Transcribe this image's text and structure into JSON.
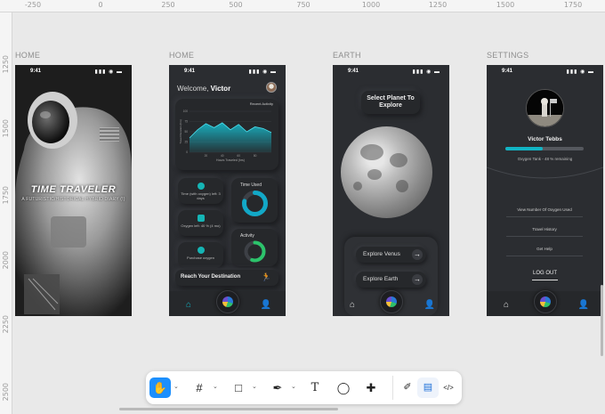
{
  "ruler": {
    "top": [
      "-250",
      "0",
      "250",
      "500",
      "750",
      "1000",
      "1250",
      "1500",
      "1750"
    ],
    "left": [
      "1250",
      "1500",
      "1750",
      "2000",
      "2250",
      "2500"
    ]
  },
  "frames": {
    "home_splash_label": "HOME",
    "home_dash_label": "HOME",
    "earth_label": "EARTH",
    "settings_label": "SETTINGS"
  },
  "status": {
    "time": "9:41",
    "icons": "▮▮▮ ◉ ▬"
  },
  "splash": {
    "title": "TIME TRAVELER",
    "subtitle": "A FUTURISTIC/HISTORICAL HYBRID DIARY (!)"
  },
  "dashboard": {
    "welcome_prefix": "Welcome,",
    "user_name": "Victor",
    "chart_title": "Recent Activity",
    "chart_xlabel": "Hours Traveled (hrs)",
    "chart_ylabel": "Travel Duration (hrs)",
    "tiles": [
      {
        "text": "Time (with oxygen) left: 3 days"
      },
      {
        "text": "Oxygen left: 40 % (4 mo)"
      },
      {
        "text": "Purchase oxygen"
      }
    ],
    "time_used_label": "Time Used",
    "activity_label": "Activity",
    "reach_label": "Reach Your Destination"
  },
  "chart_data": {
    "type": "area",
    "title": "Recent Activity",
    "xlabel": "Hours Traveled (hrs)",
    "ylabel": "Travel Duration (hrs)",
    "x": [
      0,
      10,
      20,
      30,
      40,
      50,
      60,
      70,
      80,
      90,
      100
    ],
    "xticks": [
      "20",
      "40",
      "60",
      "80"
    ],
    "yticks": [
      "0",
      "25",
      "50",
      "75",
      "100"
    ],
    "values": [
      35,
      55,
      70,
      60,
      72,
      55,
      68,
      50,
      62,
      58,
      48
    ],
    "ylim": [
      0,
      100
    ],
    "color": "#17b3c4"
  },
  "donut": {
    "fraction": 0.78,
    "color": "#12a8c7"
  },
  "activity_ring": {
    "fraction": 0.55,
    "color": "#2cc36b"
  },
  "earth": {
    "title": "Select Planet To Explore",
    "buttons": [
      "Explore Venus",
      "Explore Earth"
    ]
  },
  "settings": {
    "name": "Victor Tebbs",
    "oxygen_text": "Oxygen Tank - 48 % remaining",
    "oxygen_fraction": 0.48,
    "menu": [
      "View Number Of Oxygen Used",
      "Travel History",
      "Get Help"
    ],
    "logout": "LOG OUT"
  },
  "toolbar": {
    "hand": "✋",
    "frame": "#",
    "rect": "□",
    "pen": "✒",
    "text": "T",
    "comment": "◯",
    "components": "✚",
    "chev": "⌄",
    "draw": "✐",
    "dev": "</>",
    "design": "▤"
  },
  "colors": {
    "accent": "#12b4c4",
    "phone_bg": "#2b2d31",
    "toolbar_active": "#1c8ffd"
  }
}
